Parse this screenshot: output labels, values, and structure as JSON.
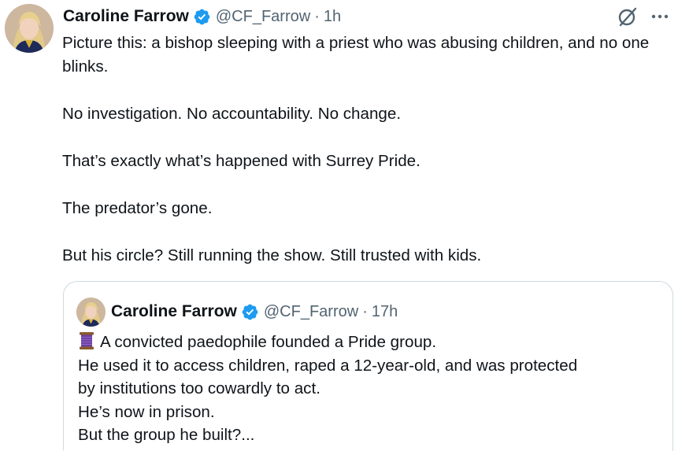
{
  "tweet": {
    "author": {
      "name": "Caroline Farrow",
      "handle": "@CF_Farrow",
      "time": "1h",
      "separator": "·",
      "verified_icon": "verified-badge-icon"
    },
    "paragraphs": [
      "Picture this: a bishop sleeping with a priest who was abusing children, and no one blinks.",
      "No investigation. No accountability. No change.",
      "That’s exactly what’s happened with Surrey Pride.",
      "The predator’s gone.",
      "But his circle? Still running the show. Still trusted with kids."
    ],
    "actions": {
      "grok_icon": "grok-icon",
      "more_icon": "more-icon"
    }
  },
  "quoted_tweet": {
    "author": {
      "name": "Caroline Farrow",
      "handle": "@CF_Farrow",
      "time": "17h",
      "separator": "·"
    },
    "lines": [
      "A convicted paedophile founded a Pride group.",
      " He used it to access children, raped a 12-year-old, and was protected",
      "by institutions too cowardly to act.",
      " He’s now in prison.",
      " But the group he built?..."
    ],
    "lead_emoji": "thread-spool-icon"
  },
  "colors": {
    "text": "#0f1419",
    "secondary": "#536471",
    "verified": "#1d9bf0",
    "border": "#cfd9de"
  }
}
